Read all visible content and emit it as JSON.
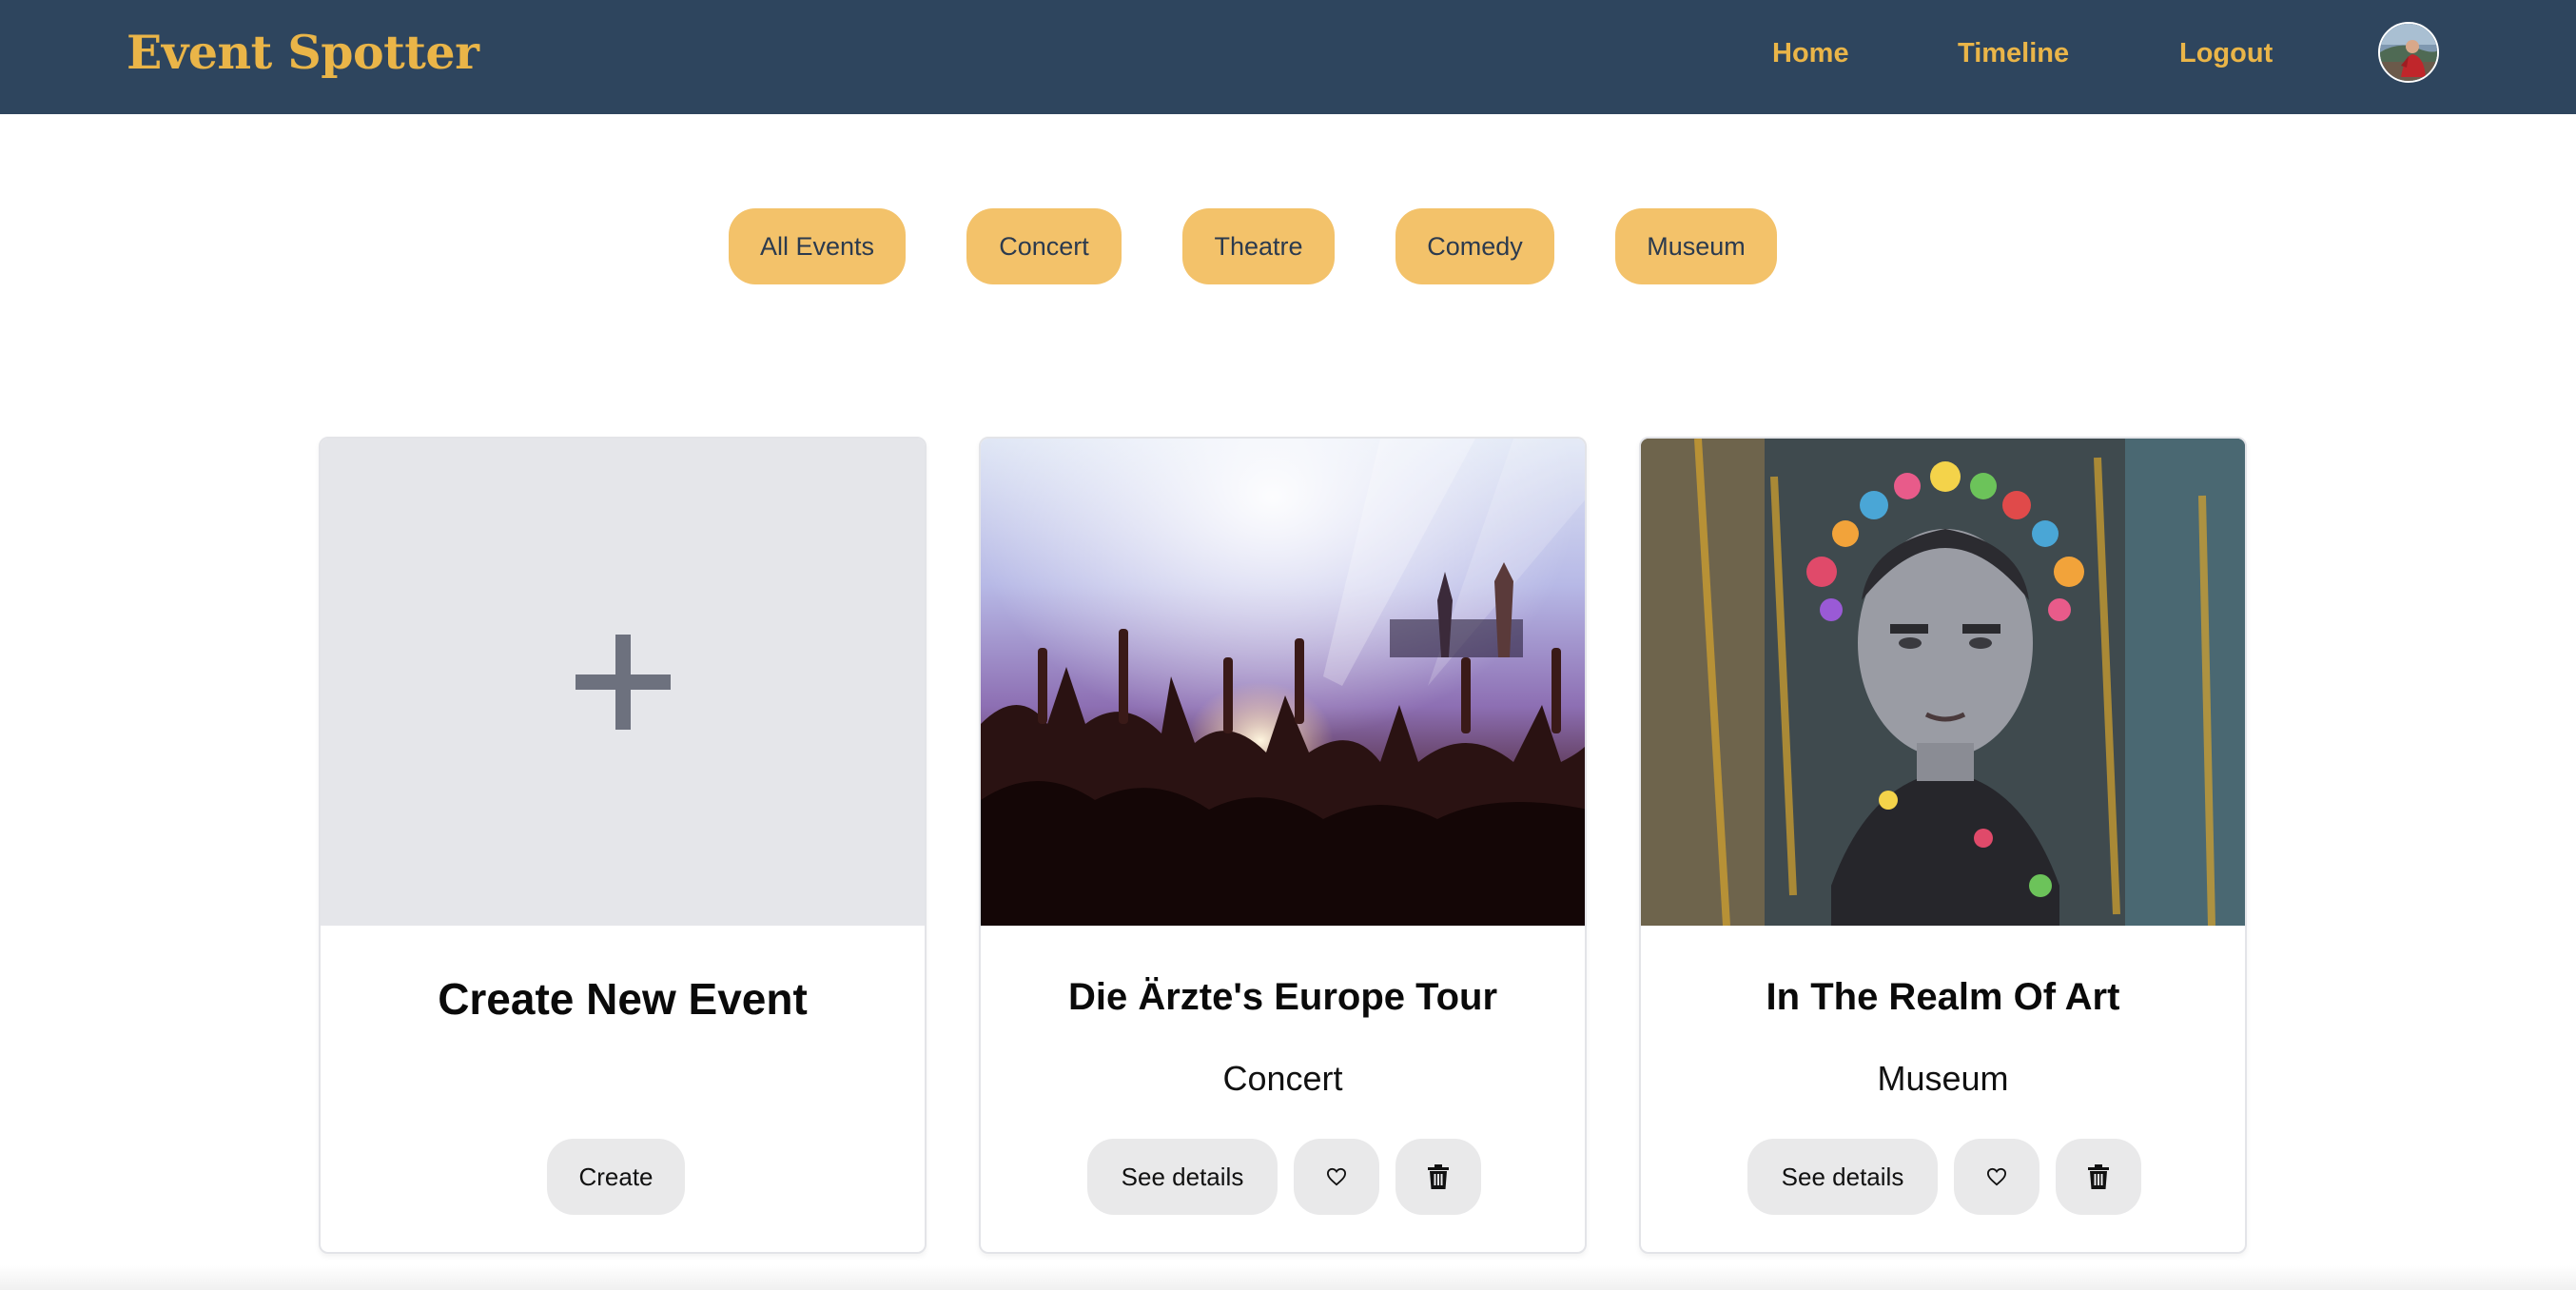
{
  "app": {
    "brand": "Event Spotter",
    "brand_color": "#eab548",
    "nav_bg": "#2e455e"
  },
  "nav": {
    "home": "Home",
    "timeline": "Timeline",
    "logout": "Logout",
    "avatar_icon": "user-avatar"
  },
  "filters": {
    "all": "All Events",
    "concert": "Concert",
    "theatre": "Theatre",
    "comedy": "Comedy",
    "museum": "Museum",
    "pill_color": "#f3c26a"
  },
  "cards": {
    "create": {
      "title": "Create New Event",
      "button": "Create",
      "icon": "plus-icon"
    },
    "event1": {
      "title": "Die Ärzte's Europe Tour",
      "category": "Concert",
      "details": "See details",
      "image": "concert-crowd-photo"
    },
    "event2": {
      "title": "In The Realm Of Art",
      "category": "Museum",
      "details": "See details",
      "image": "frida-portrait-artwork"
    }
  },
  "icons": {
    "like": "heart-icon",
    "delete": "trash-icon"
  }
}
